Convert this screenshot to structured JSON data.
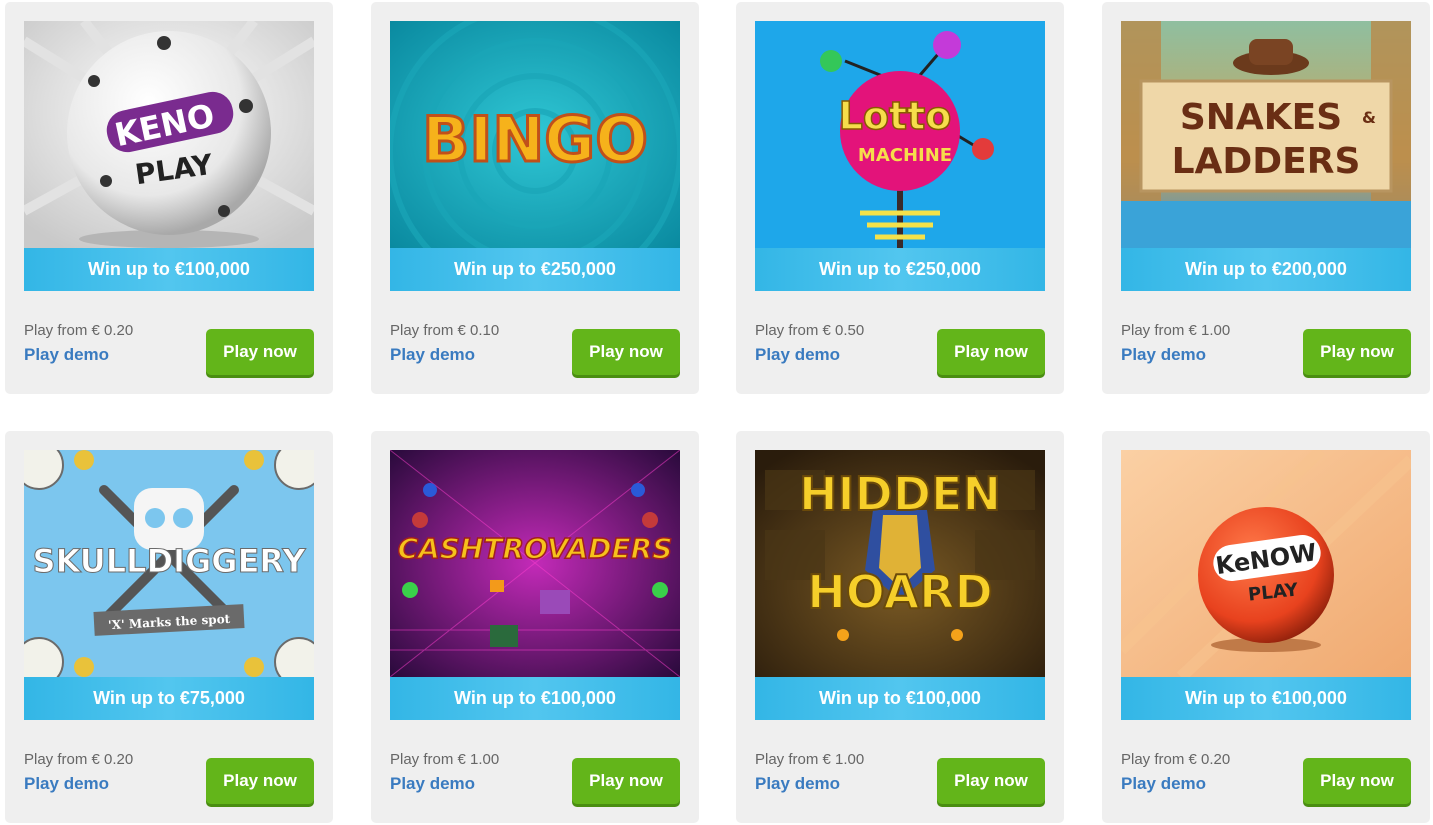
{
  "games": [
    {
      "art_label_1": "KENO",
      "art_label_2": "PLAY",
      "icon": "keno-ball-icon",
      "banner": "Win up to €100,000",
      "price": "Play from € 0.20",
      "demo_label": "Play demo",
      "play_label": "Play now"
    },
    {
      "art_label_1": "BINGO",
      "icon": "bingo-marquee-icon",
      "banner": "Win up to €250,000",
      "price": "Play from € 0.10",
      "demo_label": "Play demo",
      "play_label": "Play now"
    },
    {
      "art_label_1": "Lotto",
      "art_label_2": "MACHINE",
      "icon": "lotto-sign-icon",
      "banner": "Win up to €250,000",
      "price": "Play from € 0.50",
      "demo_label": "Play demo",
      "play_label": "Play now"
    },
    {
      "art_label_1": "SNAKES",
      "art_label_amp": "&",
      "art_label_2": "LADDERS",
      "icon": "explorer-hat-icon",
      "banner": "Win up to €200,000",
      "price": "Play from € 1.00",
      "demo_label": "Play demo",
      "play_label": "Play now"
    },
    {
      "art_label_1": "SKULLDIGGERY",
      "art_label_2": "'X' Marks the spot",
      "icon": "skull-icon",
      "banner": "Win up to €75,000",
      "price": "Play from € 0.20",
      "demo_label": "Play demo",
      "play_label": "Play now"
    },
    {
      "art_label_1": "CASHTROVADERS",
      "icon": "space-invader-icon",
      "banner": "Win up to €100,000",
      "price": "Play from € 1.00",
      "demo_label": "Play demo",
      "play_label": "Play now"
    },
    {
      "art_label_1": "HIDDEN",
      "art_label_2": "HOARD",
      "icon": "pharaoh-mask-icon",
      "banner": "Win up to €100,000",
      "price": "Play from € 1.00",
      "demo_label": "Play demo",
      "play_label": "Play now"
    },
    {
      "art_label_1": "KeNOW",
      "art_label_2": "PLAY",
      "icon": "kenow-ball-icon",
      "banner": "Win up to €100,000",
      "price": "Play from € 0.20",
      "demo_label": "Play demo",
      "play_label": "Play now"
    }
  ],
  "colors": {
    "banner": "#33b6e6",
    "play_button": "#63b51a",
    "demo_link": "#3a7bc0",
    "card_bg": "#efefef"
  }
}
